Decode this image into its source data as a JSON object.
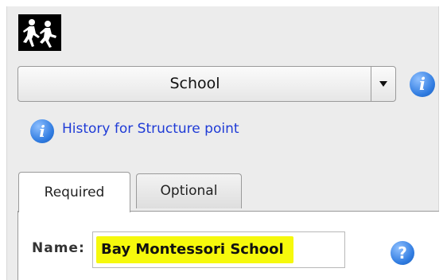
{
  "feature_type": {
    "icon": "school-children-icon",
    "selected": "School"
  },
  "history": {
    "label": "History for Structure point"
  },
  "tabs": [
    {
      "label": "Required",
      "active": true
    },
    {
      "label": "Optional",
      "active": false
    }
  ],
  "fields": {
    "name": {
      "label": "Name:",
      "value": "Bay Montessori School"
    }
  },
  "icons": {
    "info": "i",
    "help": "?"
  },
  "colors": {
    "link": "#1f3bd6",
    "highlight": "#f6f90c",
    "info_blue": "#2f7be0"
  }
}
